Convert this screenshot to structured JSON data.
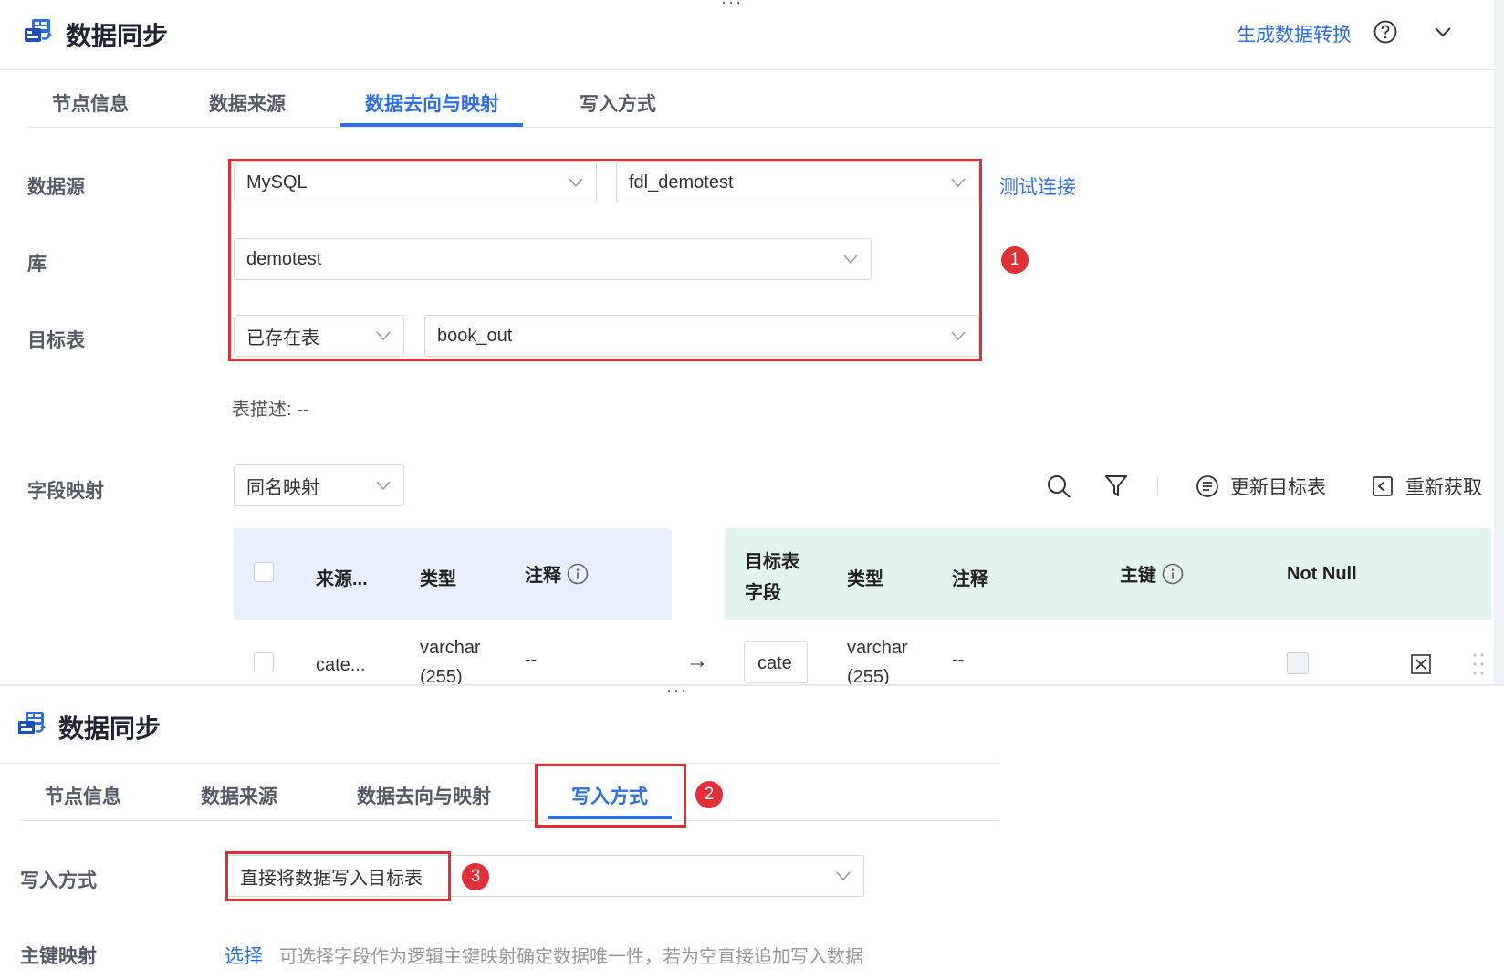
{
  "panel1": {
    "title": "数据同步",
    "header_link": "生成数据转换",
    "tabs": [
      "节点信息",
      "数据来源",
      "数据去向与映射",
      "写入方式"
    ],
    "active_tab": 2,
    "form": {
      "datasource_label": "数据源",
      "datasource_type": "MySQL",
      "datasource_conn": "fdl_demotest",
      "test_connection": "测试连接",
      "db_label": "库",
      "db_value": "demotest",
      "target_label": "目标表",
      "target_mode": "已存在表",
      "target_table": "book_out",
      "table_desc_label": "表描述:",
      "table_desc_value": "--",
      "mapping_label": "字段映射",
      "mapping_mode": "同名映射"
    },
    "toolbar": {
      "update_target": "更新目标表",
      "refetch": "重新获取"
    },
    "source_table": {
      "headers": [
        "来源...",
        "类型",
        "注释"
      ],
      "row": {
        "field": "cate...",
        "type": "varchar",
        "type_cont": "(255)",
        "comment": "--"
      }
    },
    "target_table": {
      "headers": [
        "目标表",
        "字段",
        "类型",
        "注释",
        "主键",
        "Not Null"
      ],
      "row": {
        "field": "cate",
        "type": "varchar",
        "type_cont": "(255)",
        "comment": "--"
      }
    },
    "arrow": "→",
    "badge": "1"
  },
  "panel2": {
    "title": "数据同步",
    "tabs": [
      "节点信息",
      "数据来源",
      "数据去向与映射",
      "写入方式"
    ],
    "active_tab": 3,
    "badge_tab": "2",
    "write_label": "写入方式",
    "write_value": "直接将数据写入目标表",
    "badge_write": "3",
    "pk_label": "主键映射",
    "pk_link": "选择",
    "pk_hint": "可选择字段作为逻辑主键映射确定数据唯一性，若为空直接追加写入数据"
  },
  "colors": {
    "accent": "#2f6ee8",
    "annotation": "#e02f36",
    "source_header": "#e8efff",
    "target_header": "#e3f4ef"
  }
}
